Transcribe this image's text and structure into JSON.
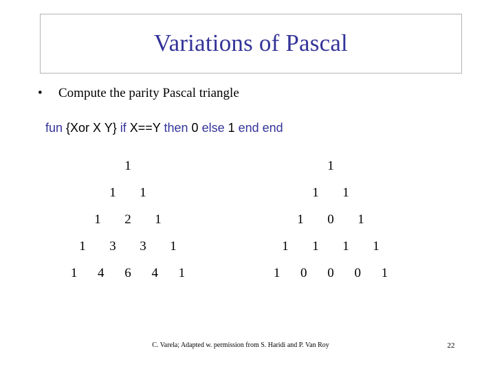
{
  "slide": {
    "title": "Variations of Pascal",
    "title_color": "#333399",
    "background_color": "#ffffff",
    "border_color": "#b3b3b3"
  },
  "bullets": [
    {
      "marker": "•",
      "text": "Compute the parity Pascal triangle"
    }
  ],
  "code": {
    "tokens": [
      {
        "text": "fun ",
        "kind": "keyword"
      },
      {
        "text": "{Xor X Y} ",
        "kind": "literal"
      },
      {
        "text": "if ",
        "kind": "keyword"
      },
      {
        "text": "X==Y ",
        "kind": "literal"
      },
      {
        "text": "then ",
        "kind": "keyword"
      },
      {
        "text": "0 ",
        "kind": "literal"
      },
      {
        "text": "else ",
        "kind": "keyword"
      },
      {
        "text": "1 ",
        "kind": "literal"
      },
      {
        "text": "end end",
        "kind": "keyword"
      }
    ],
    "plain": "fun {Xor X Y} if X==Y then 0 else 1 end end",
    "keyword_color": "#333399",
    "literal_color": "#000000"
  },
  "triangles": [
    {
      "name": "pascal-triangle",
      "rows": [
        [
          "1"
        ],
        [
          "1",
          "1"
        ],
        [
          "1",
          "2",
          "1"
        ],
        [
          "1",
          "3",
          "3",
          "1"
        ],
        [
          "1",
          "4",
          "6",
          "4",
          "1"
        ]
      ]
    },
    {
      "name": "parity-pascal-triangle",
      "rows": [
        [
          "1"
        ],
        [
          "1",
          "1"
        ],
        [
          "1",
          "0",
          "1"
        ],
        [
          "1",
          "1",
          "1",
          "1"
        ],
        [
          "1",
          "0",
          "0",
          "0",
          "1"
        ]
      ]
    }
  ],
  "footer": {
    "credit": "C. Varela;  Adapted w. permission from S. Haridi and P. Van Roy",
    "page_number": "22"
  }
}
